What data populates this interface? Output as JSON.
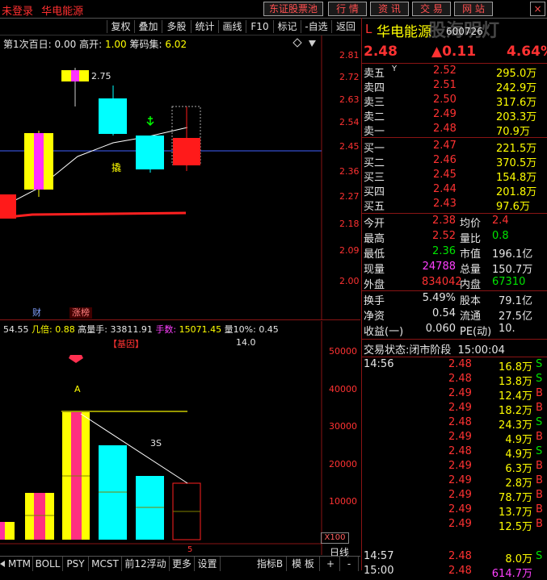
{
  "topbar": {
    "login": "未登录",
    "stock_name": "华电能源",
    "buttons": [
      "东证股票池",
      "行 情",
      "资 讯",
      "交 易",
      "网 站"
    ],
    "close": "×"
  },
  "toolbar": {
    "items": [
      "复权",
      "叠加",
      "多股",
      "统计",
      "画线",
      "F10",
      "标记",
      "-自选",
      "返回"
    ]
  },
  "kline": {
    "info_label1": "第1次百日:",
    "info_val1": "0.00",
    "info_label2": "高开:",
    "info_val2": "1.00",
    "info_label3": "筹码集:",
    "info_val3": "6.02",
    "ticks": [
      "2.81",
      "2.72",
      "2.63",
      "2.54",
      "2.45",
      "2.36",
      "2.27",
      "2.18",
      "2.09",
      "2.00"
    ],
    "annotation_top": "2.75",
    "annotation_char": "撬",
    "badge_cai": "财",
    "badge_zhangbang": "涨榜"
  },
  "volume": {
    "info_v0": "54.55",
    "info_label1": "几倍:",
    "info_v1": "0.88",
    "info_label2": "高量手:",
    "info_v2": "33811.91",
    "info_label3": "手数:",
    "info_v3": "15071.45",
    "info_label4": "量10%:",
    "info_v4": "0.45",
    "gene_label": "【基因】",
    "gene_value": "14.0",
    "ticks": [
      "50000",
      "40000",
      "30000",
      "20000",
      "10000"
    ],
    "mark_a": "A",
    "mark_3s": "3S",
    "unit": "X100",
    "bottom_num": "5"
  },
  "bottom_tabs": [
    "MTM",
    "BOLL",
    "PSY",
    "MCST",
    "前12浮动",
    "更多",
    "设置",
    "指标B",
    "模 板",
    "+",
    "-"
  ],
  "day_label": "日线",
  "quote": {
    "marker": "L",
    "name": "华电能源",
    "code": "600726",
    "watermark": "股海明灯",
    "price": "2.48",
    "change": "▲0.11",
    "pct": "4.64%",
    "asks": [
      {
        "label": "卖五",
        "flag": "Y",
        "price": "2.52",
        "vol": "295.0万"
      },
      {
        "label": "卖四",
        "flag": "",
        "price": "2.51",
        "vol": "242.9万"
      },
      {
        "label": "卖三",
        "flag": "",
        "price": "2.50",
        "vol": "317.6万"
      },
      {
        "label": "卖二",
        "flag": "",
        "price": "2.49",
        "vol": "203.3万"
      },
      {
        "label": "卖一",
        "flag": "",
        "price": "2.48",
        "vol": "70.9万"
      }
    ],
    "bids": [
      {
        "label": "买一",
        "price": "2.47",
        "vol": "221.5万"
      },
      {
        "label": "买二",
        "price": "2.46",
        "vol": "370.5万"
      },
      {
        "label": "买三",
        "price": "2.45",
        "vol": "154.8万"
      },
      {
        "label": "买四",
        "price": "2.44",
        "vol": "201.8万"
      },
      {
        "label": "买五",
        "price": "2.43",
        "vol": "97.6万"
      }
    ],
    "stats": [
      {
        "l1": "今开",
        "v1": "2.38",
        "c1": "red",
        "l2": "均价",
        "v2": "2.4",
        "c2": "red"
      },
      {
        "l1": "最高",
        "v1": "2.52",
        "c1": "red",
        "l2": "量比",
        "v2": "0.8",
        "c2": "green"
      },
      {
        "l1": "最低",
        "v1": "2.36",
        "c1": "green",
        "l2": "市值",
        "v2": "196.1亿",
        "c2": "white"
      },
      {
        "l1": "现量",
        "v1": "24788",
        "c1": "mag",
        "l2": "总量",
        "v2": "150.7万",
        "c2": "white"
      },
      {
        "l1": "外盘",
        "v1": "834042",
        "c1": "red",
        "l2": "内盘",
        "v2": "67310",
        "c2": "green"
      }
    ],
    "stats2": [
      {
        "l1": "换手",
        "v1": "5.49%",
        "l2": "股本",
        "v2": "79.1亿"
      },
      {
        "l1": "净资",
        "v1": "0.54",
        "l2": "流通",
        "v2": "27.5亿"
      },
      {
        "l1": "收益(一)",
        "v1": "0.060",
        "l2": "PE(动)",
        "v2": "10."
      }
    ],
    "trade_status_label": "交易状态:",
    "trade_status": "闭市阶段",
    "trade_time": "15:00:04",
    "ticks": [
      {
        "time": "14:56",
        "price": "2.48",
        "vol": "16.8万",
        "side": "S"
      },
      {
        "time": "",
        "price": "2.48",
        "vol": "13.8万",
        "side": "S"
      },
      {
        "time": "",
        "price": "2.49",
        "vol": "12.4万",
        "side": "B"
      },
      {
        "time": "",
        "price": "2.49",
        "vol": "18.2万",
        "side": "B"
      },
      {
        "time": "",
        "price": "2.48",
        "vol": "24.3万",
        "side": "S"
      },
      {
        "time": "",
        "price": "2.49",
        "vol": "4.9万",
        "side": "B"
      },
      {
        "time": "",
        "price": "2.48",
        "vol": "4.9万",
        "side": "S"
      },
      {
        "time": "",
        "price": "2.49",
        "vol": "6.3万",
        "side": "B"
      },
      {
        "time": "",
        "price": "2.49",
        "vol": "2.8万",
        "side": "B"
      },
      {
        "time": "",
        "price": "2.49",
        "vol": "78.7万",
        "side": "B"
      },
      {
        "time": "",
        "price": "2.49",
        "vol": "13.7万",
        "side": "B"
      },
      {
        "time": "",
        "price": "2.49",
        "vol": "12.5万",
        "side": "B"
      },
      {
        "time": "14:57",
        "price": "2.48",
        "vol": "8.0万",
        "side": "S"
      },
      {
        "time": "15:00",
        "price": "2.48",
        "vol": "614.7万",
        "side": ""
      }
    ]
  },
  "colors": {
    "up": "#ff3232",
    "down": "#00ffff",
    "axis": "#8a1414",
    "yellow": "#ffff00",
    "magenta": "#ff30ff"
  }
}
